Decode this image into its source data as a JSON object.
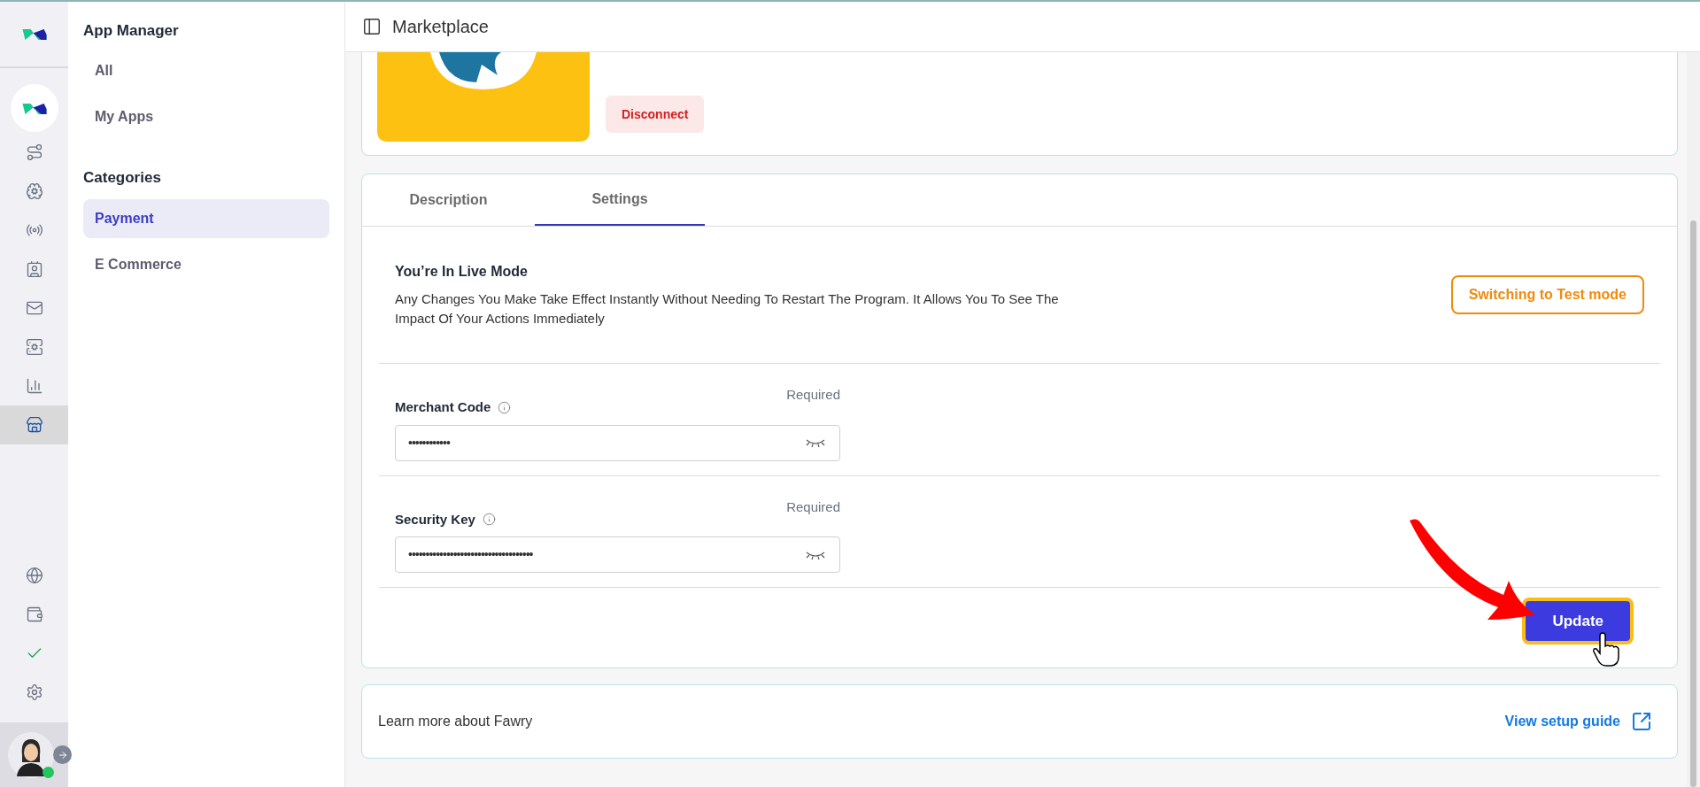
{
  "rail": {
    "items": [
      {
        "kind": "route",
        "selected": false
      },
      {
        "kind": "brain",
        "selected": false
      },
      {
        "kind": "broadcast",
        "selected": false
      },
      {
        "kind": "contact",
        "selected": false
      },
      {
        "kind": "mail",
        "selected": false
      },
      {
        "kind": "server",
        "selected": false
      },
      {
        "kind": "chart",
        "selected": false
      },
      {
        "kind": "store",
        "selected": true
      }
    ],
    "bottom_items": [
      {
        "kind": "globe"
      },
      {
        "kind": "wallet"
      },
      {
        "kind": "check"
      },
      {
        "kind": "settings"
      }
    ],
    "user": {
      "online": true
    }
  },
  "sidebar": {
    "title": "App Manager",
    "items": [
      {
        "label": "All",
        "selected": false
      },
      {
        "label": "My Apps",
        "selected": false
      }
    ],
    "categories_title": "Categories",
    "categories": [
      {
        "label": "Payment",
        "selected": true
      },
      {
        "label": "E Commerce",
        "selected": false
      }
    ]
  },
  "header": {
    "title": "Marketplace"
  },
  "app_card": {
    "disconnect": "Disconnect"
  },
  "settings_card": {
    "tabs": [
      {
        "label": "Description",
        "selected": false
      },
      {
        "label": "Settings",
        "selected": true
      }
    ],
    "mode_title": "You’re In Live Mode",
    "mode_description": "Any Changes You Make Take Effect Instantly Without Needing To Restart The Program. It Allows You To See The Impact Of Your Actions Immediately",
    "switch_button": "Switching to Test mode",
    "fields": [
      {
        "label": "Merchant Code",
        "hint": "Required",
        "value": "••••••••••••"
      },
      {
        "label": "Security Key",
        "hint": "Required",
        "value": "••••••••••••••••••••••••••••••••••••"
      }
    ],
    "update_button": "Update"
  },
  "footer_card": {
    "text": "Learn more about Fawry",
    "link": "View setup guide"
  }
}
